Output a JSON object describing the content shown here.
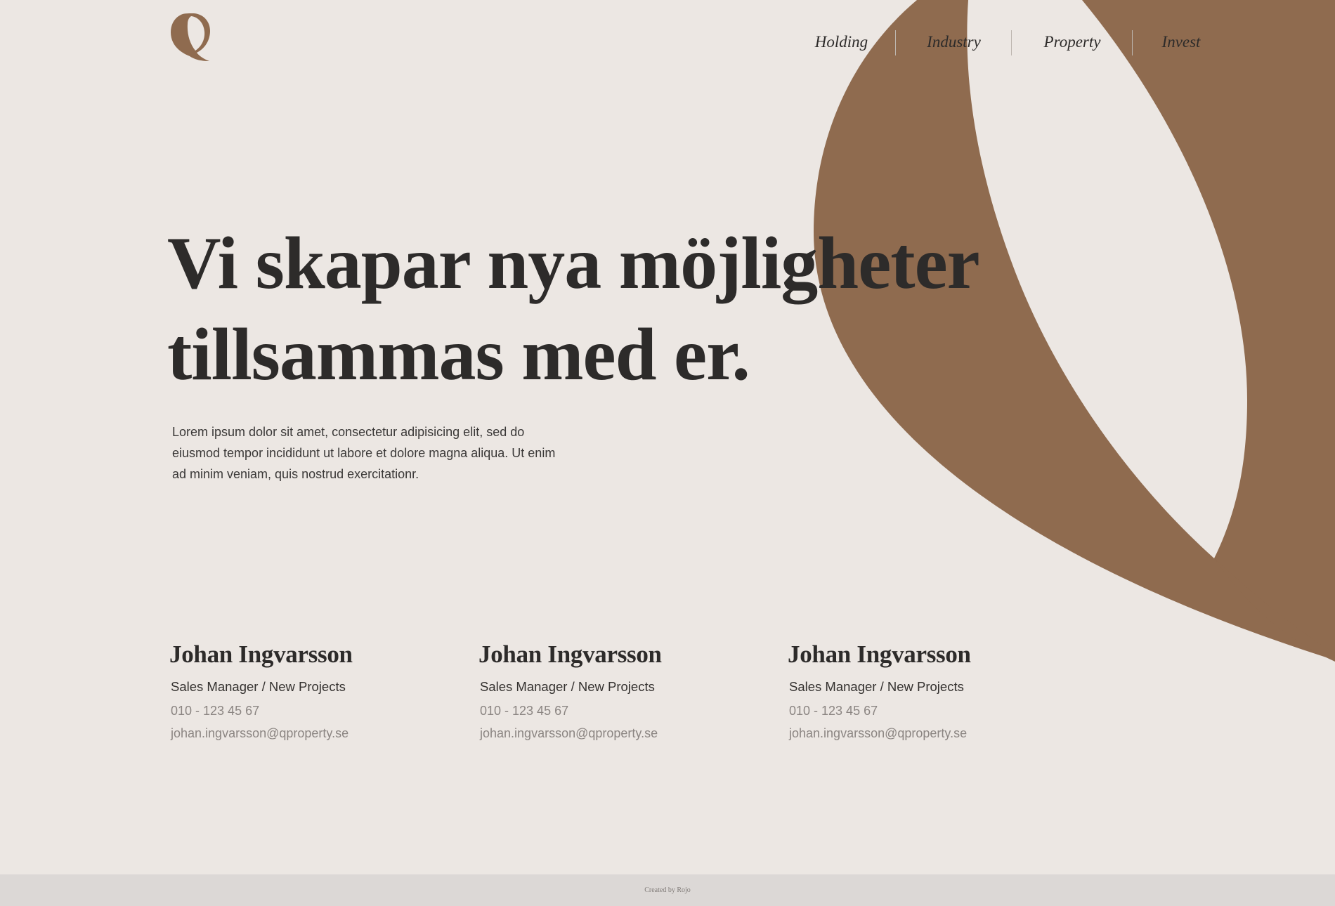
{
  "brand": {
    "accent_color": "#8f6b4f",
    "background_color": "#ece7e3",
    "text_color": "#2d2b2a",
    "logo_icon": "q-logo-icon"
  },
  "nav": {
    "items": [
      {
        "label": "Holding"
      },
      {
        "label": "Industry"
      },
      {
        "label": "Property"
      },
      {
        "label": "Invest"
      }
    ]
  },
  "hero": {
    "title_line1": "Vi skapar nya möjligheter",
    "title_line2": "tillsammas med er.",
    "body": "Lorem ipsum dolor sit amet, consectetur adipisicing elit, sed do eiusmod tempor incididunt ut labore et dolore magna aliqua. Ut enim ad minim veniam, quis nostrud exercitationr."
  },
  "contacts": [
    {
      "name": "Johan Ingvarsson",
      "role": "Sales Manager / New Projects",
      "phone": "010 - 123 45 67",
      "email": "johan.ingvarsson@qproperty.se"
    },
    {
      "name": "Johan Ingvarsson",
      "role": "Sales Manager / New Projects",
      "phone": "010 - 123 45 67",
      "email": "johan.ingvarsson@qproperty.se"
    },
    {
      "name": "Johan Ingvarsson",
      "role": "Sales Manager / New Projects",
      "phone": "010 - 123 45 67",
      "email": "johan.ingvarsson@qproperty.se"
    }
  ],
  "footer": {
    "credit": "Created by Rojo"
  }
}
